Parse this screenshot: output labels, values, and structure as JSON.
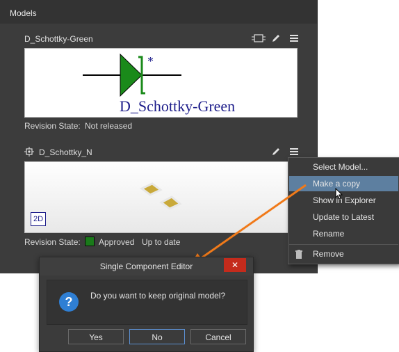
{
  "panel": {
    "title": "Models",
    "model1": {
      "name": "D_Schottky-Green",
      "preview_label": "D_Schottky-Green",
      "marker": "*",
      "revision_label": "Revision State:",
      "revision_value": "Not released"
    },
    "model2": {
      "name": "D_Schottky_N",
      "badge_2d": "2D",
      "revision_label": "Revision State:",
      "status": "Approved",
      "status_color": "#1a7a1a",
      "up_to_date": "Up to date"
    }
  },
  "context_menu": {
    "items": [
      {
        "label": "Select Model...",
        "selected": false
      },
      {
        "label": "Make a copy",
        "selected": true
      },
      {
        "label": "Show in Explorer",
        "selected": false
      },
      {
        "label": "Update to Latest",
        "selected": false
      },
      {
        "label": "Rename",
        "selected": false
      },
      {
        "label": "Remove",
        "selected": false
      }
    ]
  },
  "dialog": {
    "title": "Single Component Editor",
    "close": "✕",
    "icon": "?",
    "message": "Do you want to keep original model?",
    "buttons": {
      "yes": "Yes",
      "no": "No",
      "cancel": "Cancel"
    }
  },
  "colors": {
    "accent_arrow": "#f07a1a",
    "menu_highlight": "#5d7fa0",
    "diode_green": "#1a8a1a"
  },
  "icons": [
    "schematic-icon",
    "edit-icon",
    "menu-icon",
    "pcb-footprint-icon",
    "trash-icon"
  ]
}
